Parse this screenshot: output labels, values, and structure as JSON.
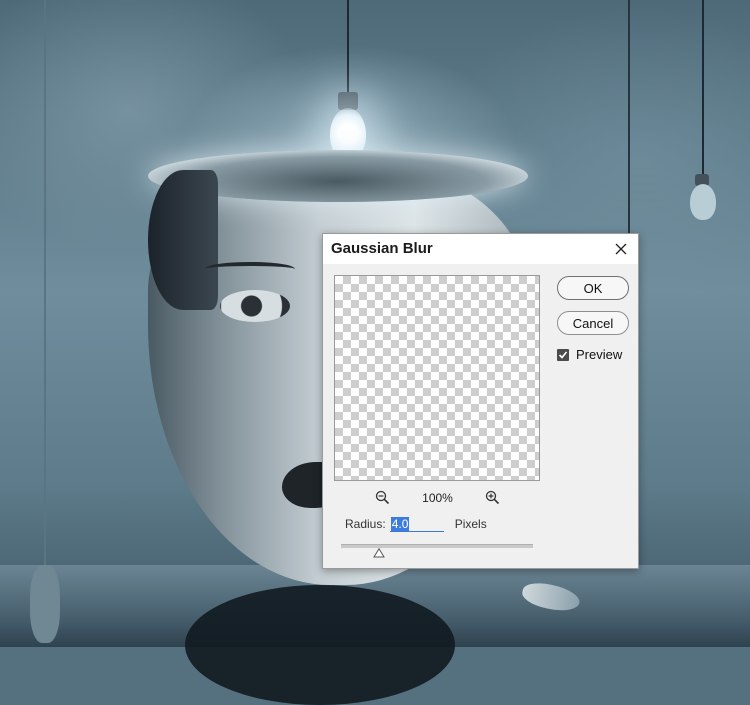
{
  "dialog": {
    "title": "Gaussian Blur",
    "ok_label": "OK",
    "cancel_label": "Cancel",
    "preview_label": "Preview",
    "preview_checked": true,
    "zoom_level": "100%",
    "radius_label": "Radius:",
    "radius_value": "4.0",
    "radius_unit": "Pixels",
    "slider_fraction": 0.2
  },
  "icons": {
    "close": "close-icon",
    "zoom_out": "zoom-out-icon",
    "zoom_in": "zoom-in-icon",
    "check": "check-icon",
    "slider_thumb": "triangle-thumb"
  },
  "colors": {
    "selection": "#3e7be0",
    "checkbox": "#4b4b4b"
  }
}
